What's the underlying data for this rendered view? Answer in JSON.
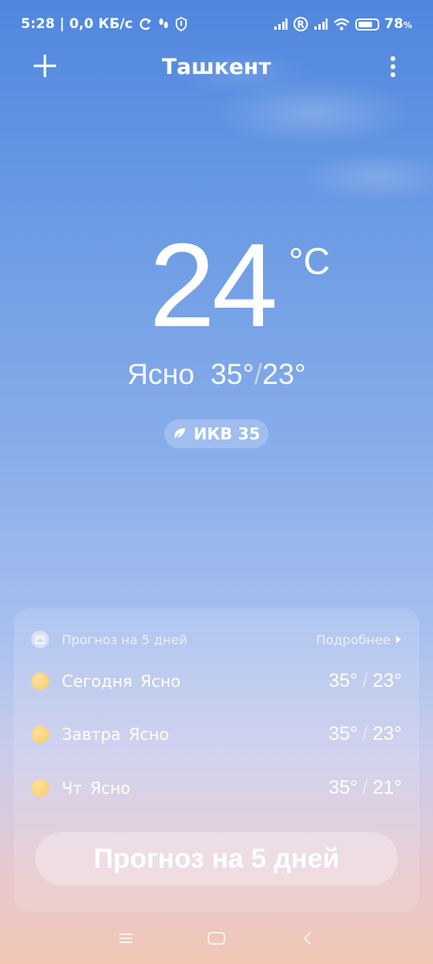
{
  "status_bar": {
    "time": "5:28",
    "net_speed": "| 0,0 КБ/с",
    "battery": "78",
    "battery_unit": "%",
    "battery_level": 0.78
  },
  "header": {
    "city": "Ташкент"
  },
  "current": {
    "temperature": "24",
    "unit": "°C",
    "condition": "Ясно",
    "high": "35°",
    "low": "23°",
    "aqi_label": "ИКВ 35"
  },
  "forecast_card": {
    "title": "Прогноз на 5 дней",
    "more_label": "Подробнее",
    "days": [
      {
        "day": "Сегодня",
        "condition": "Ясно",
        "high": "35°",
        "low": "23°"
      },
      {
        "day": "Завтра",
        "condition": "Ясно",
        "high": "35°",
        "low": "23°"
      },
      {
        "day": "Чт",
        "condition": "Ясно",
        "high": "35°",
        "low": "21°"
      }
    ],
    "button_label": "Прогноз на 5 дней"
  },
  "colors": {
    "sky_top": "#4f86de",
    "sky_bottom": "#f2c7b5",
    "sun": "#f8c965"
  }
}
